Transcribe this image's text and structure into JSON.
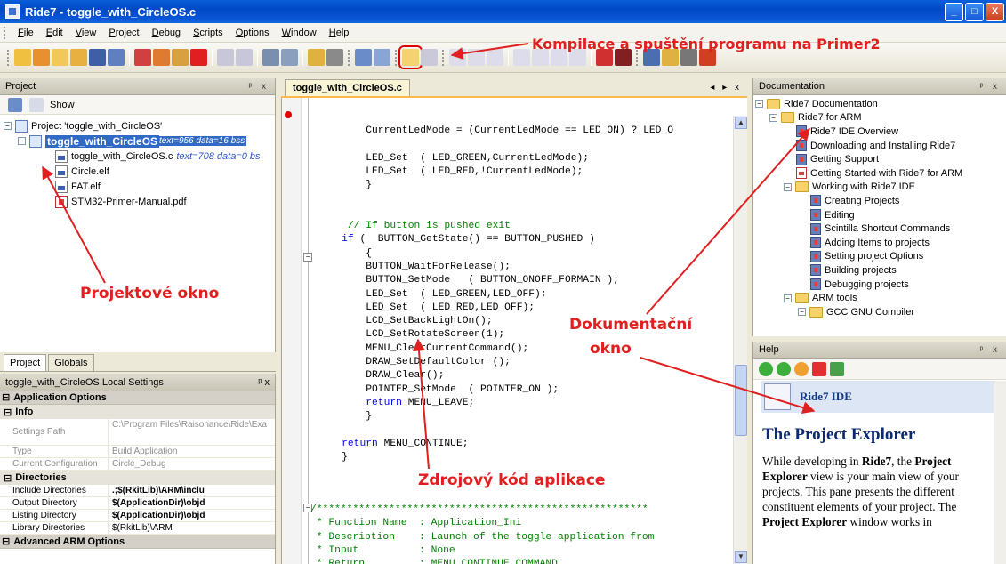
{
  "window": {
    "title": "Ride7 - toggle_with_CircleOS.c",
    "buttons": [
      "_",
      "□",
      "X"
    ]
  },
  "menu": [
    "File",
    "Edit",
    "View",
    "Project",
    "Debug",
    "Scripts",
    "Options",
    "Window",
    "Help"
  ],
  "project_panel": {
    "title": "Project",
    "pin": "ᵖ x",
    "show_label": "Show",
    "tree": {
      "root": "Project 'toggle_with_CircleOS'",
      "app": "toggle_with_CircleOS",
      "app_meta": "text=956 data=16 bss",
      "file1": "toggle_with_CircleOS.c",
      "file1_meta": "text=708 data=0 bs",
      "file2": "Circle.elf",
      "file3": "FAT.elf",
      "file4": "STM32-Primer-Manual.pdf"
    },
    "tabs": [
      "Project",
      "Globals"
    ]
  },
  "settings_panel": {
    "title": "toggle_with_CircleOS Local Settings",
    "pin": "ᵖ x",
    "group1": "Application Options",
    "sub_info": "Info",
    "rows_info": [
      {
        "k": "Settings Path",
        "v": "C:\\Program Files\\Raisonance\\Ride\\Exa"
      },
      {
        "k": "Type",
        "v": "Build Application"
      },
      {
        "k": "Current Configuration",
        "v": "Circle_Debug"
      }
    ],
    "sub_dirs": "Directories",
    "rows_dirs": [
      {
        "k": "Include Directories",
        "v": ".;$(RkitLib)\\ARM\\inclu"
      },
      {
        "k": "Output Directory",
        "v": "$(ApplicationDir)\\objd"
      },
      {
        "k": "Listing Directory",
        "v": "$(ApplicationDir)\\objd"
      },
      {
        "k": "Library Directories",
        "v": "$(RkitLib)\\ARM"
      }
    ],
    "group2": "Advanced ARM Options"
  },
  "editor": {
    "tab": "toggle_with_CircleOS.c",
    "tab_controls": "◂ ▸ x"
  },
  "documentation_panel": {
    "title": "Documentation",
    "pin": "ᵖ x",
    "items": [
      "Ride7 Documentation",
      "Ride7 for ARM",
      "Ride7 IDE Overview",
      "Downloading and Installing Ride7",
      "Getting Support",
      "Getting Started with Ride7 for ARM",
      "Working with Ride7 IDE",
      "Creating Projects",
      "Editing",
      "Scintilla Shortcut Commands",
      "Adding Items to projects",
      "Setting project Options",
      "Building projects",
      "Debugging projects",
      "ARM tools",
      "GCC GNU Compiler"
    ]
  },
  "help_panel": {
    "title": "Help",
    "pin": "ᵖ x",
    "banner": "Ride7 IDE",
    "heading": "The Project Explorer",
    "body_pre": "While developing in ",
    "body_b1": "Ride7",
    "body_mid": ", the ",
    "body_b2": "Project Explorer",
    "body_rest": " view is your main view of your projects. This pane presents the different constituent elements of your project. The ",
    "body_b3": "Project Explorer",
    "body_end": " window works in"
  },
  "annotations": {
    "compile": "Kompilace a spuštění programu na Primer2",
    "project_window": "Projektové okno",
    "doc_window_1": "Dokumentační",
    "doc_window_2": "okno",
    "source_code": "Zdrojový kód aplikace"
  },
  "colors": {
    "annotation": "#e02020",
    "selection": "#316ac5",
    "title_bar": "#0a55d6"
  }
}
